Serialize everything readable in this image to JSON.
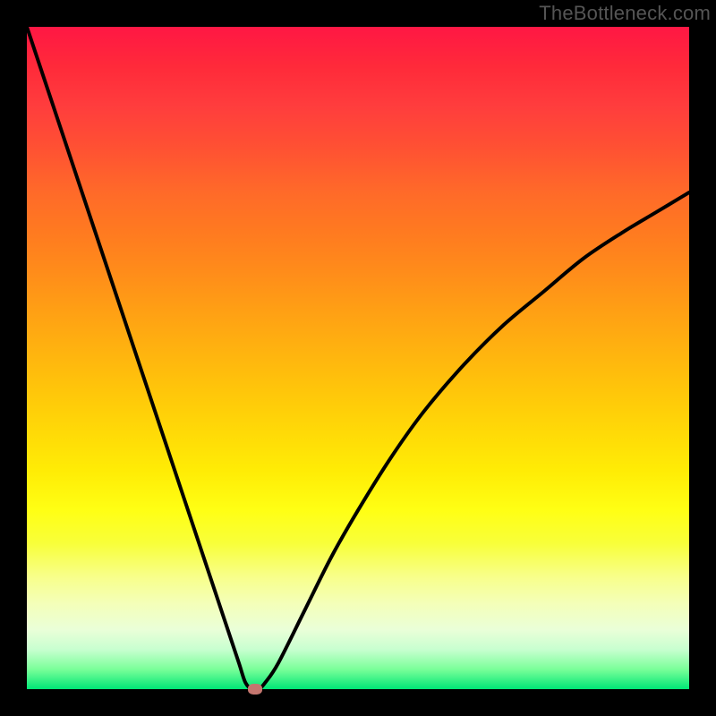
{
  "watermark": "TheBottleneck.com",
  "colors": {
    "frame": "#000000",
    "curve": "#000000",
    "marker": "#c5766f",
    "gradient_top": "#ff1744",
    "gradient_bottom": "#00e676"
  },
  "chart_data": {
    "type": "line",
    "title": "",
    "xlabel": "",
    "ylabel": "",
    "xlim": [
      0,
      100
    ],
    "ylim": [
      0,
      100
    ],
    "annotations": [],
    "series": [
      {
        "name": "bottleneck-curve",
        "x": [
          0,
          4,
          8,
          12,
          16,
          20,
          24,
          27,
          30,
          32,
          33,
          34,
          35,
          36,
          38,
          42,
          46,
          50,
          55,
          60,
          66,
          72,
          78,
          84,
          90,
          95,
          100
        ],
        "y": [
          100,
          88,
          76,
          64,
          52,
          40,
          28,
          19,
          10,
          4,
          1,
          0,
          0,
          1,
          4,
          12,
          20,
          27,
          35,
          42,
          49,
          55,
          60,
          65,
          69,
          72,
          75
        ]
      }
    ],
    "marker": {
      "x": 34.5,
      "y": 0
    }
  }
}
